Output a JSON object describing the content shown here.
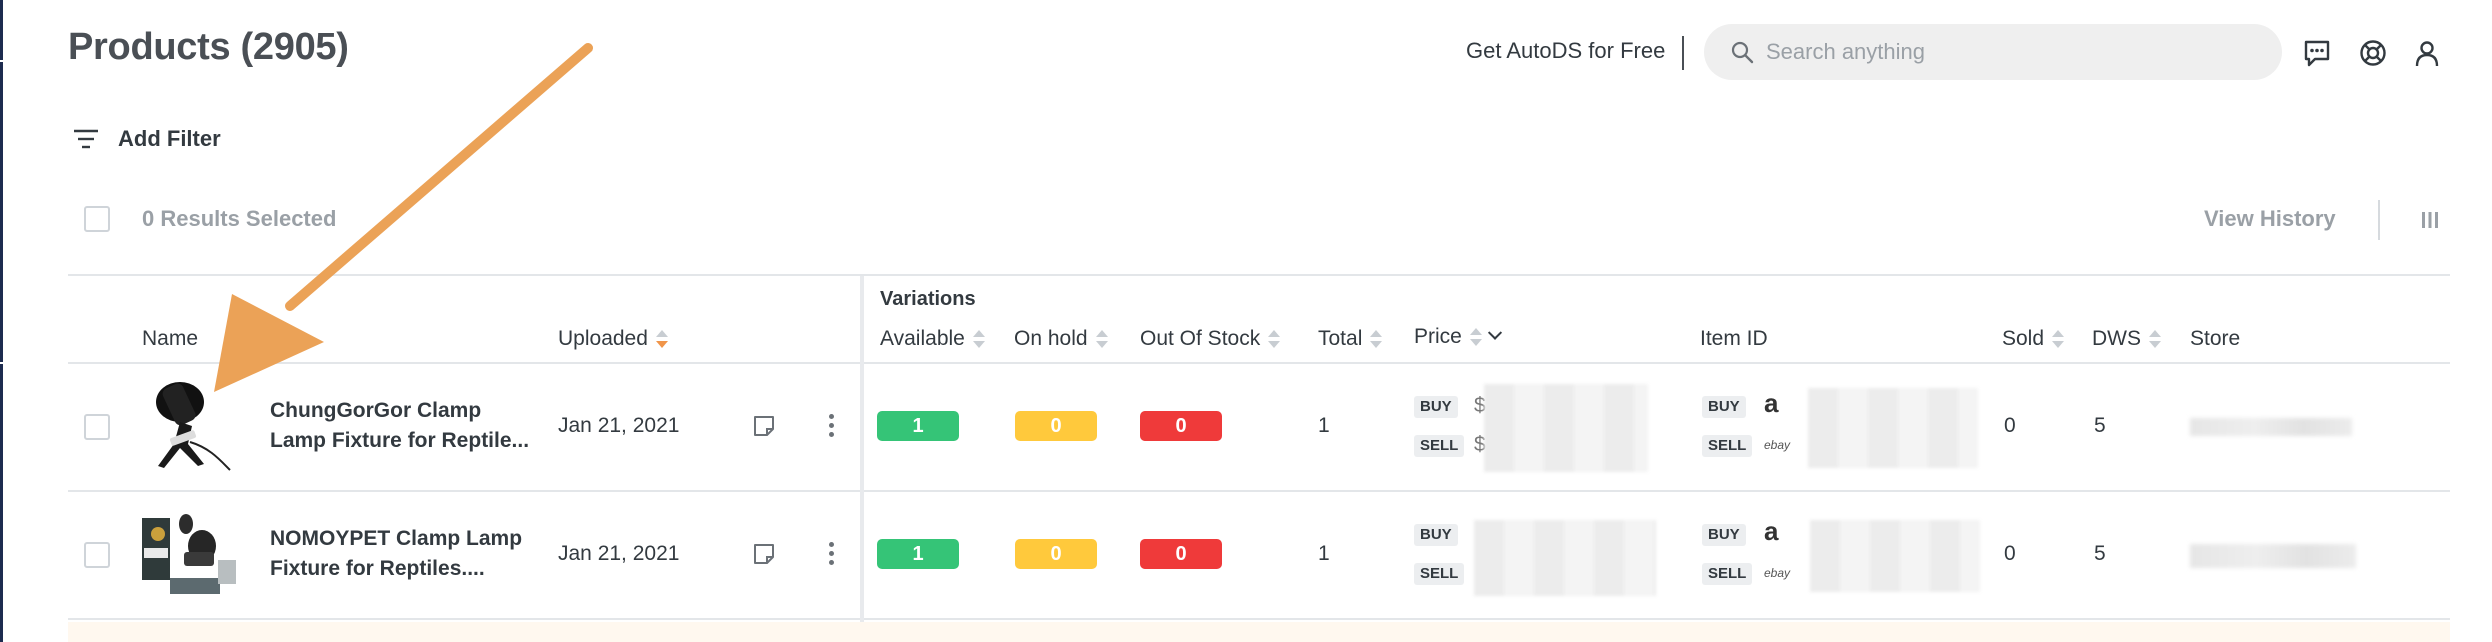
{
  "header": {
    "title": "Products (2905)",
    "promo_link": "Get AutoDS for Free",
    "search_placeholder": "Search anything",
    "icons": [
      "chat-icon",
      "help-icon",
      "user-icon"
    ]
  },
  "filter": {
    "label": "Add Filter"
  },
  "toolbar": {
    "selected_label": "0 Results Selected",
    "view_history": "View History"
  },
  "table": {
    "group_header": "Variations",
    "columns": {
      "name": "Name",
      "uploaded": "Uploaded",
      "available": "Available",
      "on_hold": "On hold",
      "out_of_stock": "Out Of Stock",
      "total": "Total",
      "price": "Price",
      "item_id": "Item ID",
      "sold": "Sold",
      "dws": "DWS",
      "store": "Store"
    },
    "rows": [
      {
        "name_line1": "ChungGorGor Clamp",
        "name_line2": "Lamp Fixture for Reptile...",
        "uploaded": "Jan 21, 2021",
        "available": "1",
        "on_hold": "0",
        "out_of_stock": "0",
        "total": "1",
        "price_buy_tag": "BUY",
        "price_sell_tag": "SELL",
        "price_buy_prefix": "$",
        "price_sell_prefix": "$",
        "item_buy_tag": "BUY",
        "item_sell_tag": "SELL",
        "item_buy_brand": "a",
        "item_sell_brand": "ebay",
        "sold": "0",
        "dws": "5"
      },
      {
        "name_line1": "NOMOYPET Clamp Lamp",
        "name_line2": "Fixture for Reptiles....",
        "uploaded": "Jan 21, 2021",
        "available": "1",
        "on_hold": "0",
        "out_of_stock": "0",
        "total": "1",
        "price_buy_tag": "BUY",
        "price_sell_tag": "SELL",
        "price_buy_prefix": "",
        "price_sell_prefix": "",
        "item_buy_tag": "BUY",
        "item_sell_tag": "SELL",
        "item_buy_brand": "a",
        "item_sell_brand": "ebay",
        "sold": "0",
        "dws": "5"
      }
    ]
  },
  "colors": {
    "available": "#35c477",
    "on_hold": "#ffc93c",
    "out_of_stock": "#ef3a3a",
    "sort_active": "#f0954a",
    "annotation_arrow": "#eba257"
  }
}
